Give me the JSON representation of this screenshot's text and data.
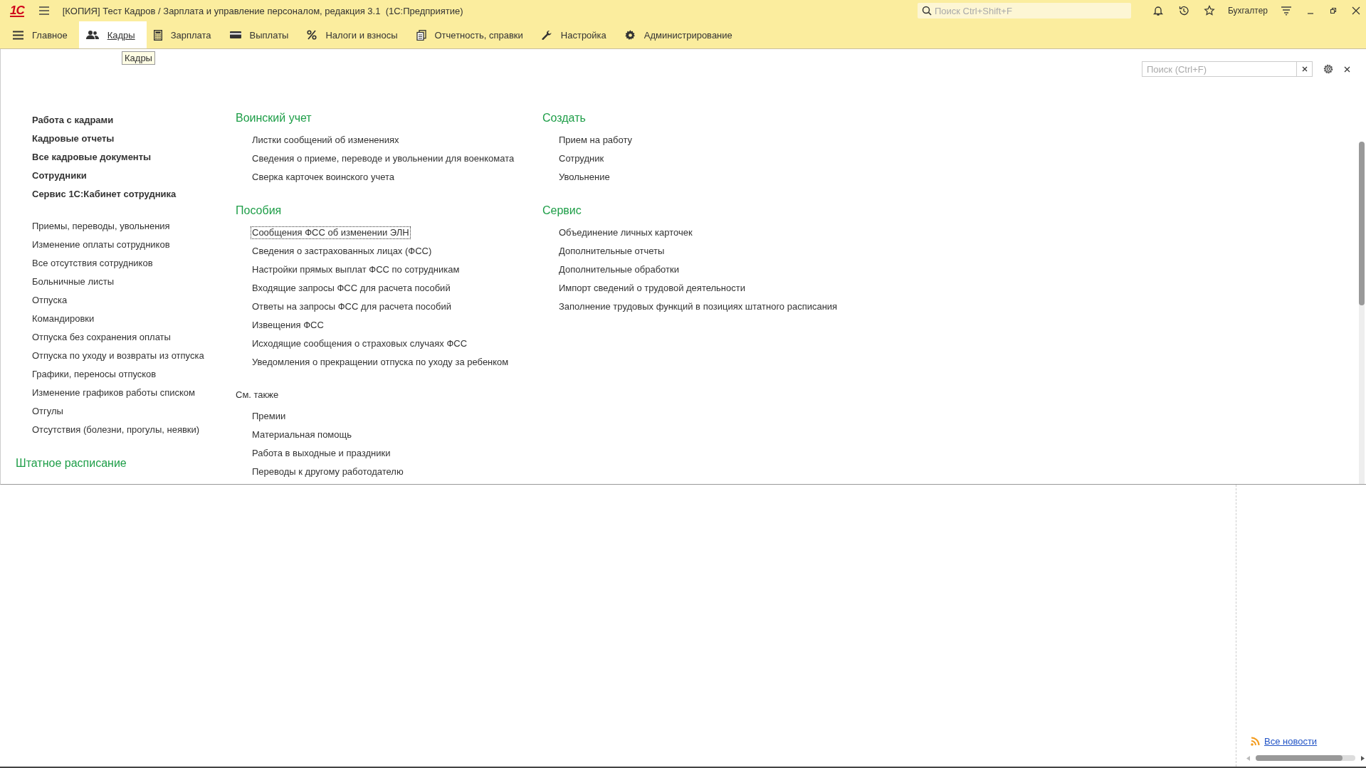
{
  "title_bar": {
    "logo": "1С",
    "title": "[КОПИЯ] Тест Кадров / Зарплата и управление персоналом, редакция 3.1  (1С:Предприятие)",
    "search_placeholder": "Поиск Ctrl+Shift+F",
    "user": "Бухгалтер"
  },
  "nav_tabs": [
    {
      "label": "Главное",
      "selected": false
    },
    {
      "label": "Кадры",
      "selected": true
    },
    {
      "label": "Зарплата",
      "selected": false
    },
    {
      "label": "Выплаты",
      "selected": false
    },
    {
      "label": "Налоги и взносы",
      "selected": false
    },
    {
      "label": "Отчетность, справки",
      "selected": false
    },
    {
      "label": "Настройка",
      "selected": false
    },
    {
      "label": "Администрирование",
      "selected": false
    }
  ],
  "tooltip": "Кадры",
  "panel": {
    "search_placeholder": "Поиск (Ctrl+F)",
    "left": {
      "primary": [
        "Работа с кадрами",
        "Кадровые отчеты",
        "Все кадровые документы",
        "Сотрудники",
        "Сервис 1С:Кабинет сотрудника"
      ],
      "secondary": [
        "Приемы, переводы, увольнения",
        "Изменение оплаты сотрудников",
        "Все отсутствия сотрудников",
        "Больничные листы",
        "Отпуска",
        "Командировки",
        "Отпуска без сохранения оплаты",
        "Отпуска по уходу и возвраты из отпуска",
        "Графики, переносы отпусков",
        "Изменение графиков работы списком",
        "Отгулы",
        "Отсутствия (болезни, прогулы, неявки)"
      ],
      "section_heading": "Штатное расписание"
    },
    "middle": [
      {
        "heading": "Воинский учет",
        "items": [
          {
            "label": "Листки сообщений об изменениях",
            "focused": false
          },
          {
            "label": "Сведения о приеме, переводе и увольнении для военкомата",
            "focused": false
          },
          {
            "label": "Сверка карточек воинского учета",
            "focused": false
          }
        ]
      },
      {
        "heading": "Пособия",
        "items": [
          {
            "label": "Сообщения ФСС об изменении ЭЛН",
            "focused": true
          },
          {
            "label": "Сведения о застрахованных лицах (ФСС)",
            "focused": false
          },
          {
            "label": "Настройки прямых выплат ФСС по сотрудникам",
            "focused": false
          },
          {
            "label": "Входящие запросы ФСС для расчета пособий",
            "focused": false
          },
          {
            "label": "Ответы на запросы ФСС для расчета пособий",
            "focused": false
          },
          {
            "label": "Извещения ФСС",
            "focused": false
          },
          {
            "label": "Исходящие сообщения о страховых случаях ФСС",
            "focused": false
          },
          {
            "label": "Уведомления о прекращении отпуска по уходу за ребенком",
            "focused": false
          }
        ]
      }
    ],
    "see_also": {
      "heading": "См. также",
      "items": [
        "Премии",
        "Материальная помощь",
        "Работа в выходные и праздники",
        "Переводы к другому работодателю"
      ]
    },
    "right": [
      {
        "heading": "Создать",
        "items": [
          {
            "label": "Прием на работу",
            "focused": false
          },
          {
            "label": "Сотрудник",
            "focused": false
          },
          {
            "label": "Увольнение",
            "focused": false
          }
        ]
      },
      {
        "heading": "Сервис",
        "items": [
          {
            "label": "Объединение личных карточек",
            "focused": false
          },
          {
            "label": "Дополнительные отчеты",
            "focused": false
          },
          {
            "label": "Дополнительные обработки",
            "focused": false
          },
          {
            "label": "Импорт сведений о трудовой деятельности",
            "focused": false
          },
          {
            "label": "Заполнение трудовых функций в позициях штатного расписания",
            "focused": false
          }
        ]
      }
    ]
  },
  "news_link": "Все новости"
}
